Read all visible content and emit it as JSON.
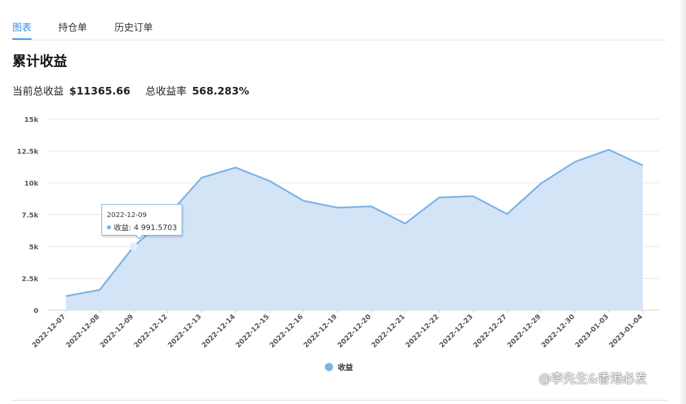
{
  "tabs": [
    {
      "label": "图表",
      "active": true
    },
    {
      "label": "持仓单",
      "active": false
    },
    {
      "label": "历史订单",
      "active": false
    }
  ],
  "title": "累计收益",
  "summary": {
    "current_total_label": "当前总收益",
    "current_total_value": "$11365.66",
    "rate_label": "总收益率",
    "rate_value": "568.283%"
  },
  "tooltip": {
    "date": "2022-12-09",
    "series_label": "收益:",
    "value_text": "4 991.5703"
  },
  "watermark": "@李先生&香港必发",
  "colors": {
    "series": "#7cb3e6",
    "area": "#d3e4f7",
    "accent": "#3a8ee6"
  },
  "chart_data": {
    "type": "area",
    "x": [
      "2022-12-07",
      "2022-12-08",
      "2022-12-09",
      "2022-12-12",
      "2022-12-13",
      "2022-12-14",
      "2022-12-15",
      "2022-12-16",
      "2022-12-19",
      "2022-12-20",
      "2022-12-21",
      "2022-12-22",
      "2022-12-23",
      "2022-12-27",
      "2022-12-29",
      "2022-12-30",
      "2023-01-03",
      "2023-01-04"
    ],
    "series": [
      {
        "name": "收益",
        "values": [
          1100,
          1600,
          4991.5703,
          7400,
          10400,
          11200,
          10150,
          8600,
          8050,
          8150,
          6800,
          8850,
          8950,
          7550,
          9950,
          11650,
          12600,
          11365.66
        ]
      }
    ],
    "yticks": [
      "0",
      "2.5k",
      "5k",
      "7.5k",
      "10k",
      "12.5k",
      "15k"
    ],
    "ylim": [
      0,
      15000
    ],
    "legend": "bottom-center",
    "grid": true,
    "highlighted_category": "2022-12-09"
  }
}
